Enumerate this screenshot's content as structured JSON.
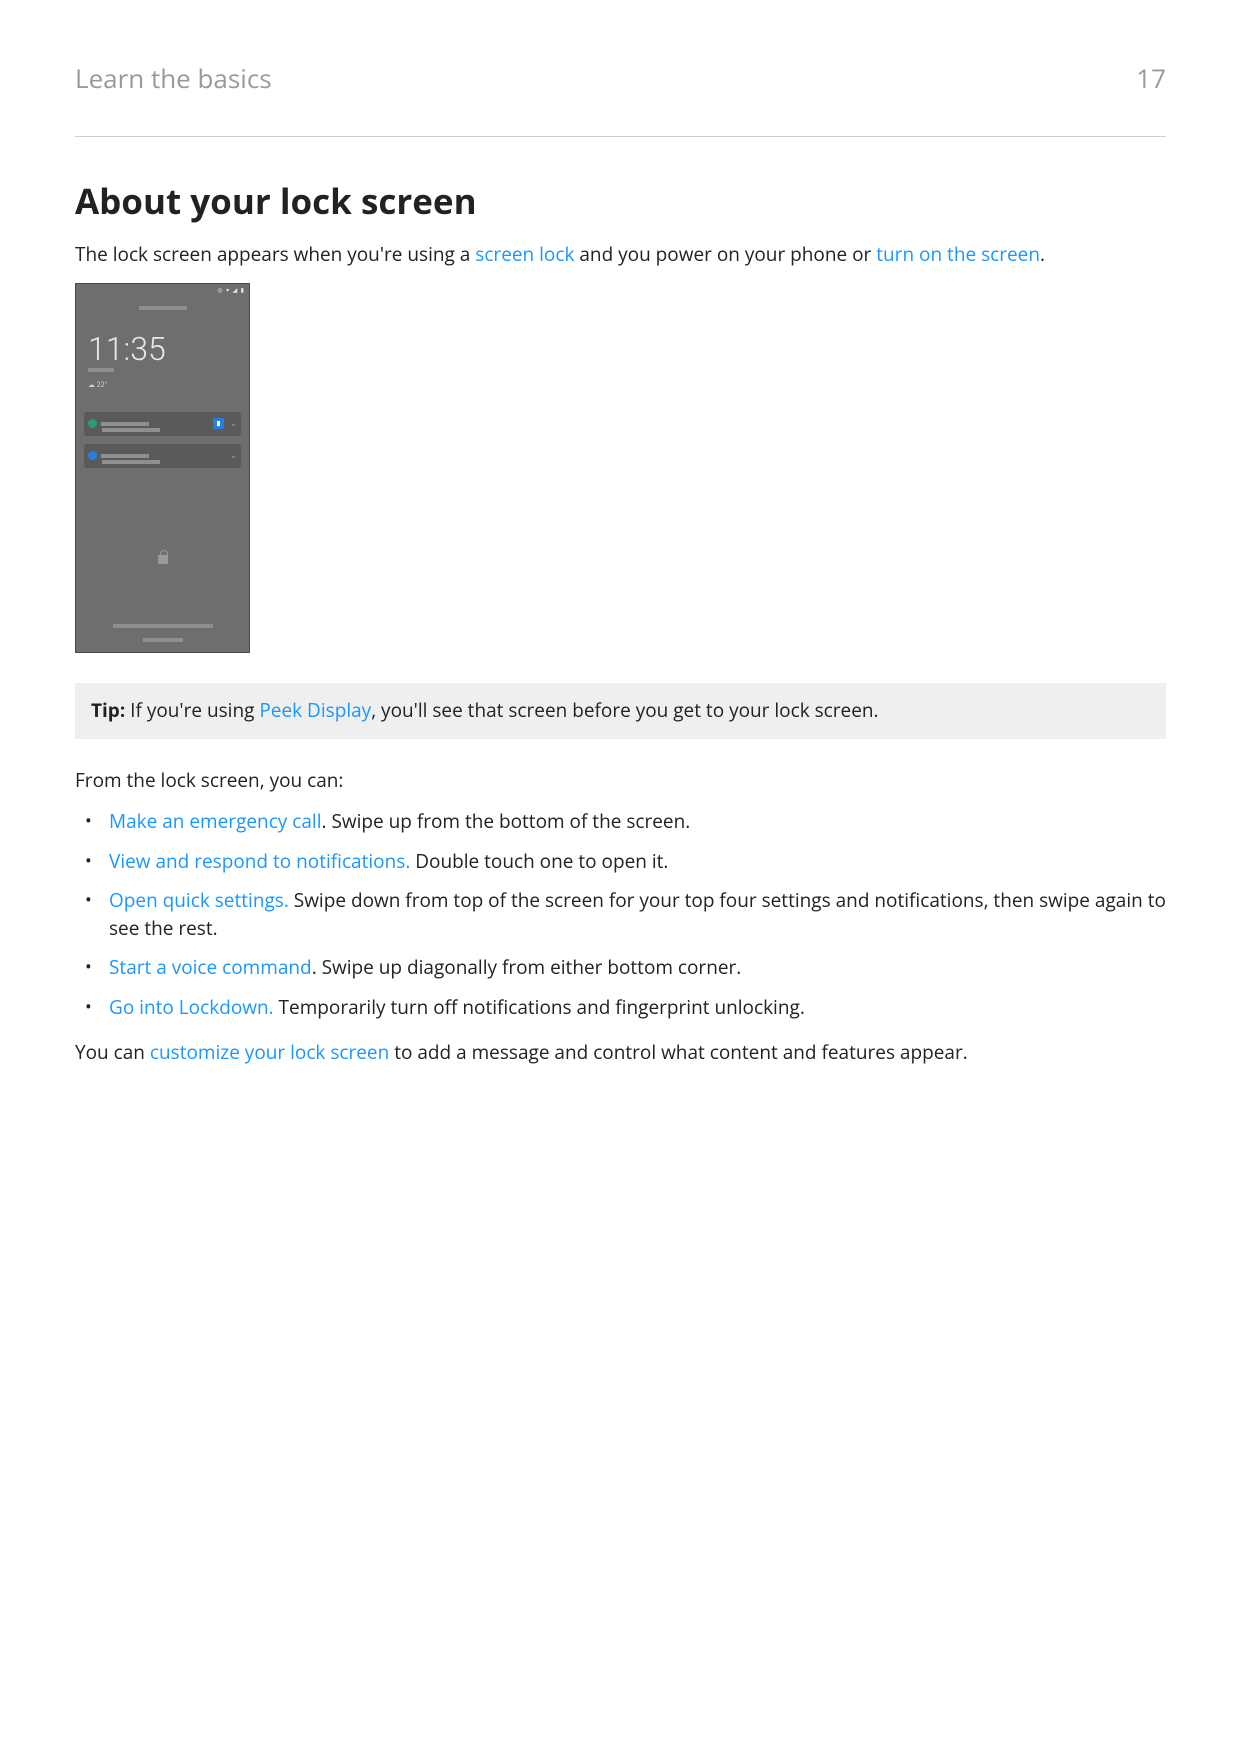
{
  "header": {
    "breadcrumb": "Learn the basics",
    "page_number": "17"
  },
  "heading": "About your lock screen",
  "intro": {
    "pre": "The lock screen appears when you're using a ",
    "link1": "screen lock",
    "mid": " and you power on your phone or ",
    "link2": "turn on the screen",
    "post": "."
  },
  "phone": {
    "status_icons": "◎ ▾ ◢ ▮",
    "clock": "11:35",
    "weather": "☁ 22°"
  },
  "tip": {
    "label": "Tip:",
    "pre": " If you're using ",
    "link": "Peek Display",
    "post": ", you'll see that screen before you get to your lock screen."
  },
  "list_intro": "From the lock screen, you can:",
  "bullets": [
    {
      "link": "Make an emergency call",
      "rest": ". Swipe up from the bottom of the screen."
    },
    {
      "link": "View and respond to notifications.",
      "rest": " Double touch one to open it."
    },
    {
      "link": "Open quick settings.",
      "rest": " Swipe down from top of the screen for your top four settings and notifications, then swipe again to see the rest."
    },
    {
      "link": "Start a voice command",
      "rest": ". Swipe up diagonally from either bottom corner."
    },
    {
      "link": "Go into Lockdown.",
      "rest": " Temporarily turn off notifications and fingerprint unlocking."
    }
  ],
  "closing": {
    "pre": "You can ",
    "link": "customize your lock screen",
    "post": " to add a message and control what content and features appear."
  }
}
